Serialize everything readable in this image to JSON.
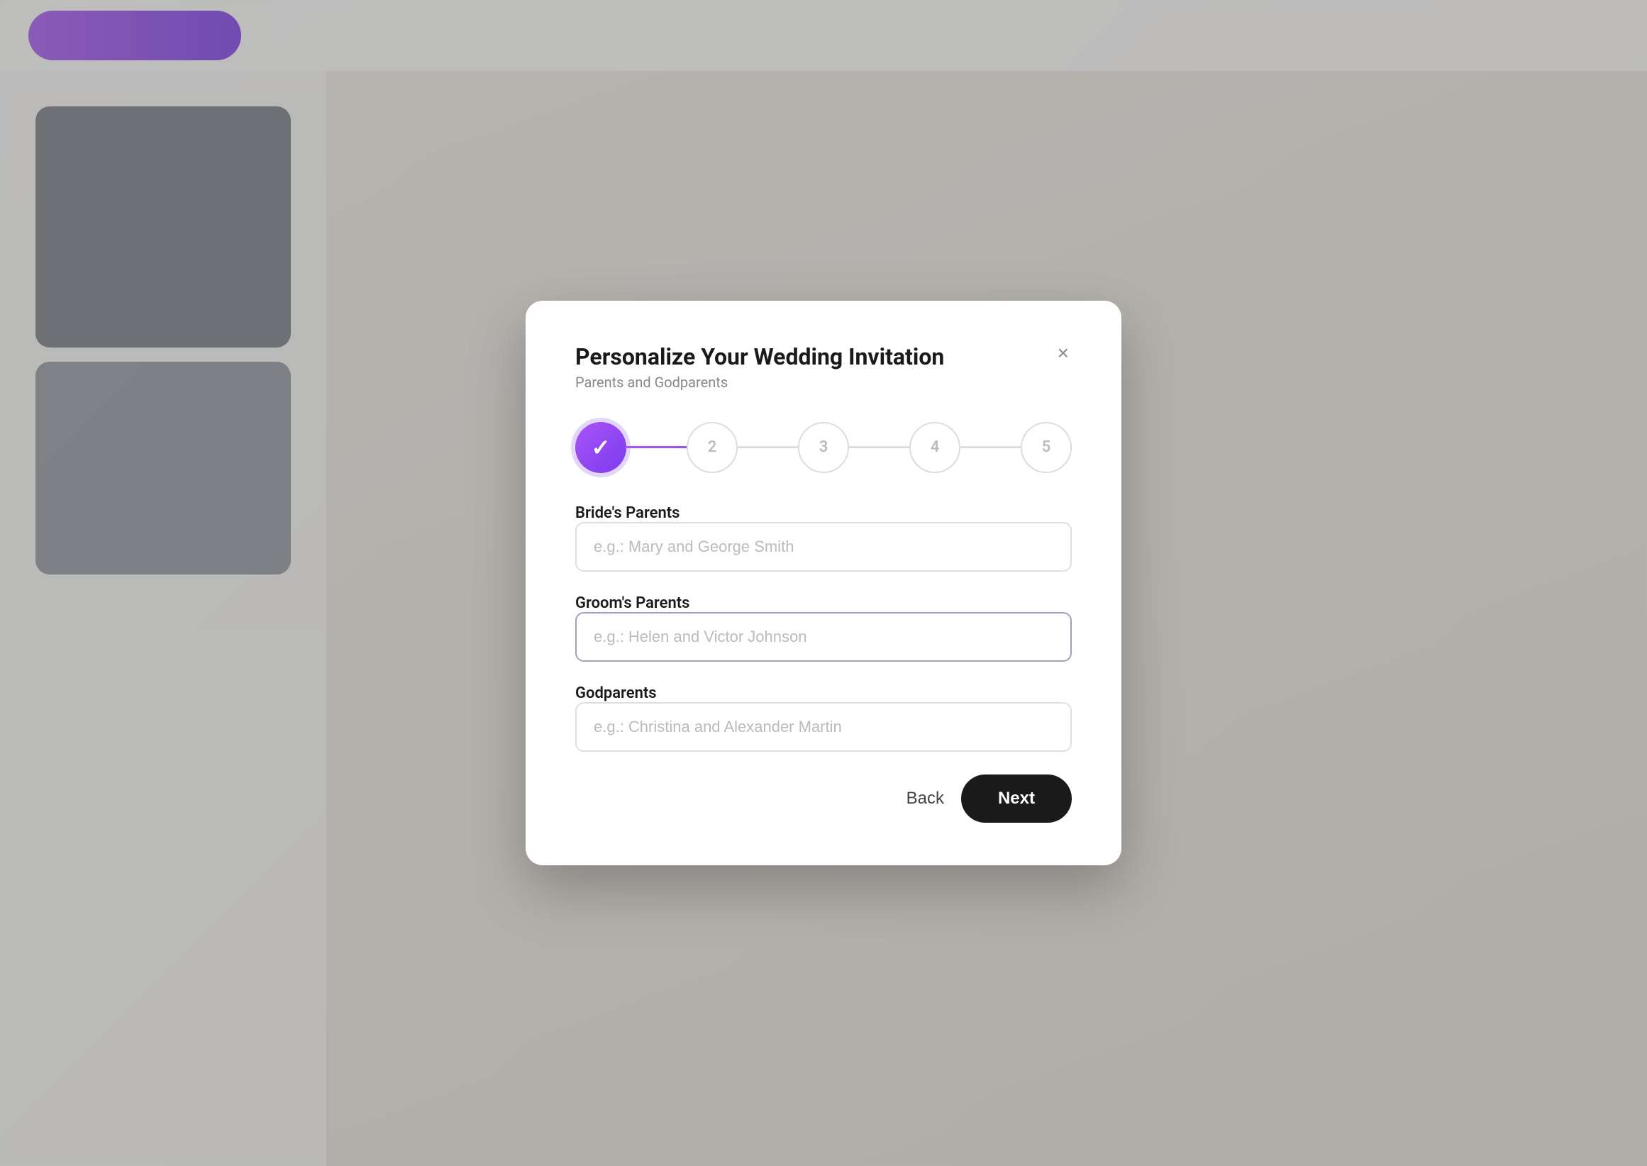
{
  "modal": {
    "title": "Personalize Your Wedding Invitation",
    "subtitle": "Parents and Godparents",
    "close_label": "×",
    "steps": [
      {
        "number": "✓",
        "state": "active"
      },
      {
        "number": "2",
        "state": "inactive"
      },
      {
        "number": "3",
        "state": "inactive"
      },
      {
        "number": "4",
        "state": "inactive"
      },
      {
        "number": "5",
        "state": "inactive"
      }
    ],
    "connectors": [
      {
        "state": "active"
      },
      {
        "state": "inactive"
      },
      {
        "state": "inactive"
      },
      {
        "state": "inactive"
      }
    ],
    "fields": [
      {
        "id": "brides-parents",
        "label": "Bride's Parents",
        "placeholder": "e.g.: Mary and George Smith",
        "value": ""
      },
      {
        "id": "grooms-parents",
        "label": "Groom's Parents",
        "placeholder": "e.g.: Helen and Victor Johnson",
        "value": ""
      },
      {
        "id": "godparents",
        "label": "Godparents",
        "placeholder": "e.g.: Christina and Alexander Martin",
        "value": ""
      }
    ],
    "footer": {
      "back_label": "Back",
      "next_label": "Next"
    }
  }
}
